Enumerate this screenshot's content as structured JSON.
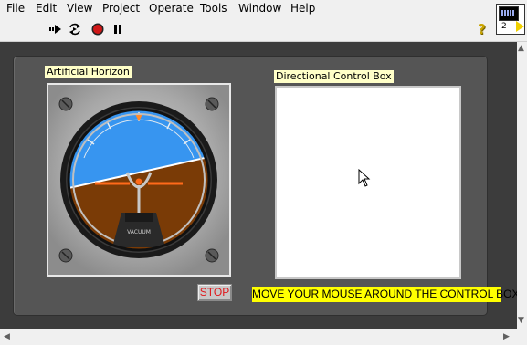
{
  "menu": {
    "items": [
      "File",
      "Edit",
      "View",
      "Project",
      "Operate",
      "Tools",
      "Window",
      "Help"
    ]
  },
  "toolbar": {
    "icons": [
      "run-arrow-icon",
      "run-continuously-icon",
      "abort-stop-icon",
      "pause-icon"
    ],
    "help_glyph": "?",
    "vi_icon_number": "2"
  },
  "panel": {
    "horizon_label": "Artificial Horizon",
    "control_box_label": "Directional Control Box",
    "gauge_text": "VACUUM",
    "stop_label": "STOP",
    "instructions": "MOVE YOUR MOUSE AROUND THE CONTROL BOX"
  },
  "colors": {
    "sky": "#3795f0",
    "ground": "#7a3b06",
    "stop_text": "#e0181c",
    "instructions_bg": "#ffff00",
    "label_bg": "#ffffc8"
  }
}
